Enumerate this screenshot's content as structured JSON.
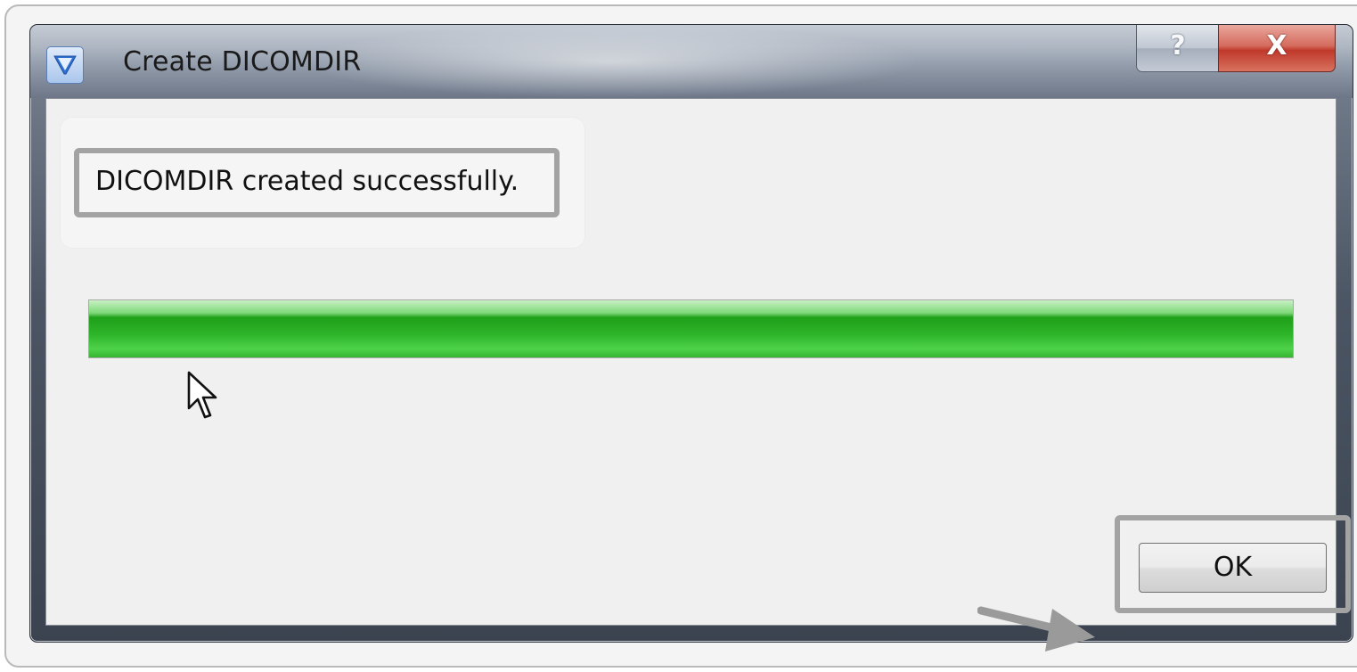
{
  "window": {
    "title": "Create DICOMDIR",
    "help_label": "?",
    "close_label": "X"
  },
  "icons": {
    "app": "funnel-icon",
    "cursor": "mouse-pointer-icon",
    "callout": "arrow-right-icon"
  },
  "message": {
    "text": "DICOMDIR created successfully."
  },
  "progress": {
    "percent": 100,
    "color": "#2eb52a"
  },
  "buttons": {
    "ok_label": "OK"
  },
  "colors": {
    "highlight_frame": "#a3a3a3",
    "close_button": "#c0392b",
    "progress_fill": "#2eb52a"
  }
}
